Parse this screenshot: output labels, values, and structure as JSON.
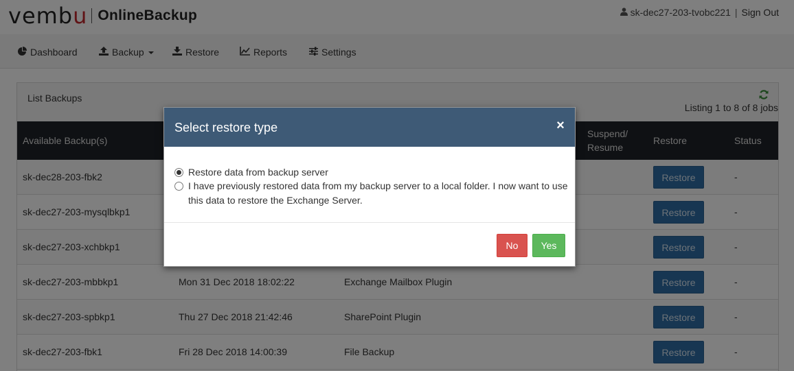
{
  "header": {
    "logo_prefix": "vemb",
    "logo_accent": "u",
    "product": "OnlineBackup",
    "username": "sk-dec27-203-tvobc221",
    "separator": "|",
    "sign_out": "Sign Out"
  },
  "nav": [
    {
      "label": "Dashboard",
      "icon": "pie-chart-icon"
    },
    {
      "label": "Backup",
      "icon": "upload-icon"
    },
    {
      "label": "Restore",
      "icon": "download-icon"
    },
    {
      "label": "Reports",
      "icon": "line-chart-icon"
    },
    {
      "label": "Settings",
      "icon": "sliders-icon"
    }
  ],
  "panel": {
    "title": "List Backups",
    "listing": "Listing 1 to 8 of 8 jobs"
  },
  "table": {
    "columns": [
      "Available Backup(s)",
      "Suspend/",
      "Resume",
      "Restore",
      "Status"
    ],
    "rows": [
      {
        "name": "sk-dec28-203-fbk2",
        "date": "",
        "plugin": "",
        "restore": "Restore",
        "status": "-"
      },
      {
        "name": "sk-dec27-203-mysqlbkp1",
        "date": "",
        "plugin": "",
        "restore": "Restore",
        "status": "-"
      },
      {
        "name": "sk-dec27-203-xchbkp1",
        "date": "",
        "plugin": "",
        "restore": "Restore",
        "status": "-"
      },
      {
        "name": "sk-dec27-203-mbbkp1",
        "date": "Mon 31 Dec 2018 18:02:22",
        "plugin": "Exchange Mailbox Plugin",
        "restore": "Restore",
        "status": "-"
      },
      {
        "name": "sk-dec27-203-spbkp1",
        "date": "Thu 27 Dec 2018 21:42:46",
        "plugin": "SharePoint Plugin",
        "restore": "Restore",
        "status": "-"
      },
      {
        "name": "sk-dec27-203-fbk1",
        "date": "Fri 28 Dec 2018 14:00:39",
        "plugin": "File Backup",
        "restore": "Restore",
        "status": "-"
      }
    ]
  },
  "modal": {
    "title": "Select restore type",
    "close": "×",
    "option1": "Restore data from backup server",
    "option2_line1": "I have previously restored data from my backup server to a local folder. I now want to use",
    "option2_line2": "this data to restore the Exchange Server.",
    "selected_option": 1,
    "no_label": "No",
    "yes_label": "Yes"
  },
  "colors": {
    "modal_header": "#3e5a76",
    "restore_button": "#2e6da4",
    "no_button": "#d9534f",
    "yes_button": "#5cb85c",
    "brand_accent": "#c0262d",
    "table_header": "#1e2228"
  }
}
